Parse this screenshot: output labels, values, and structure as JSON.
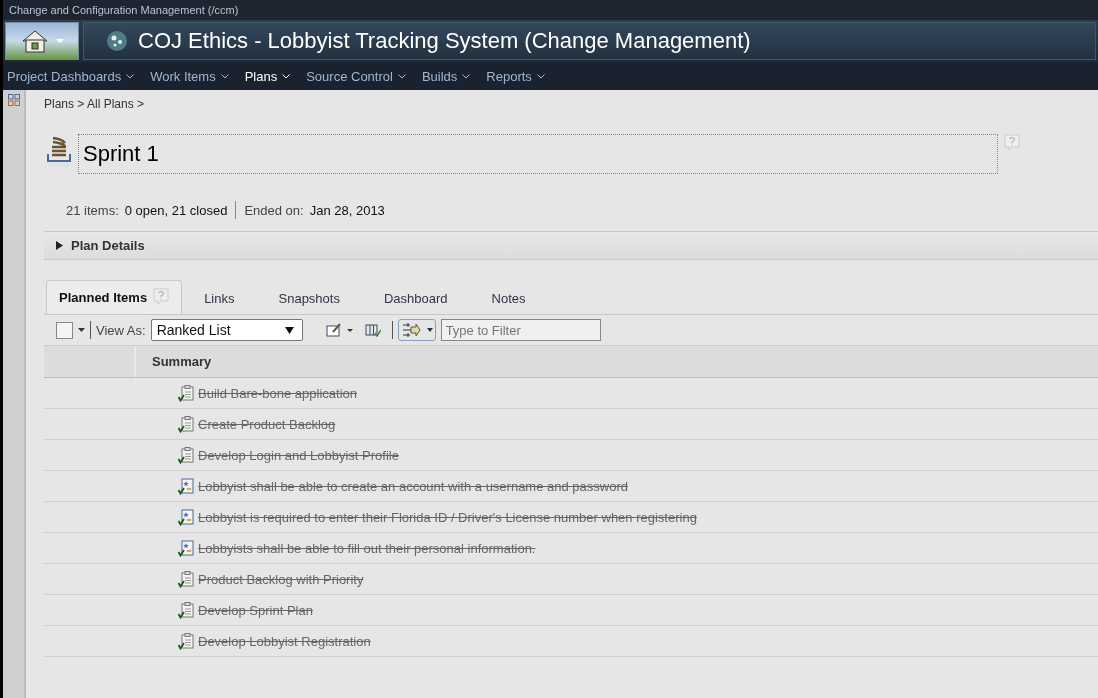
{
  "window": {
    "title": "Change and Configuration Management (/ccm)"
  },
  "project_title": "COJ Ethics - Lobbyist Tracking System (Change Management)",
  "nav": [
    {
      "label": "Project Dashboards",
      "selected": false
    },
    {
      "label": "Work Items",
      "selected": false
    },
    {
      "label": "Plans",
      "selected": true
    },
    {
      "label": "Source Control",
      "selected": false
    },
    {
      "label": "Builds",
      "selected": false
    },
    {
      "label": "Reports",
      "selected": false
    }
  ],
  "breadcrumb": "Plans > All Plans >",
  "plan": {
    "name": "Sprint 1",
    "items_label": "21 items:",
    "items_value": "0 open, 21 closed",
    "ended_label": "Ended on:",
    "ended_value": "Jan 28, 2013"
  },
  "plan_details": {
    "label": "Plan Details",
    "expanded": false
  },
  "tabs": [
    {
      "label": "Planned Items",
      "selected": true
    },
    {
      "label": "Links",
      "selected": false
    },
    {
      "label": "Snapshots",
      "selected": false
    },
    {
      "label": "Dashboard",
      "selected": false
    },
    {
      "label": "Notes",
      "selected": false
    }
  ],
  "toolbar": {
    "select_all_checked": false,
    "view_as_label": "View As:",
    "view_as_value": "Ranked List",
    "filter": {
      "placeholder": "Type to Filter"
    }
  },
  "table": {
    "columns": [
      "Summary"
    ],
    "rows": [
      {
        "summary": "Build Bare-bone application",
        "kind": "task",
        "closed": true
      },
      {
        "summary": "Create Product Backlog",
        "kind": "task",
        "closed": true
      },
      {
        "summary": "Develop Login and Lobbyist Profile",
        "kind": "task",
        "closed": true
      },
      {
        "summary": "Lobbyist shall be able to create an account with a username and password",
        "kind": "story",
        "closed": true
      },
      {
        "summary": "Lobbyist is required to enter their Florida ID / Driver's License number when registering",
        "kind": "story",
        "closed": true
      },
      {
        "summary": "Lobbyists shall be able to fill out their personal information.",
        "kind": "story",
        "closed": true
      },
      {
        "summary": "Product Backlog with Priority",
        "kind": "task",
        "closed": true
      },
      {
        "summary": "Develop Sprint Plan",
        "kind": "task",
        "closed": true
      },
      {
        "summary": "Develop Lobbyist Registration",
        "kind": "task",
        "closed": true
      }
    ]
  }
}
